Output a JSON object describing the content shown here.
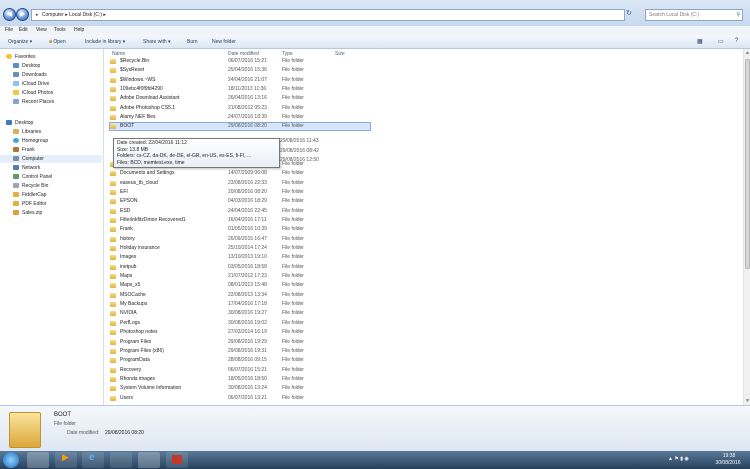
{
  "address": {
    "crumbs": [
      "Computer",
      "Local Disk (C:)"
    ],
    "search_placeholder": "Search Local Disk (C:)"
  },
  "menu": [
    "File",
    "Edit",
    "View",
    "Tools",
    "Help"
  ],
  "toolbar": {
    "organize": "Organize ▾",
    "open": "Open",
    "include": "Include in library ▾",
    "share": "Share with ▾",
    "burn": "Burn",
    "newfolder": "New folder"
  },
  "nav": {
    "favorites": "Favorites",
    "fav_items": [
      "Desktop",
      "Downloads",
      "iCloud Drive",
      "iCloud Photos",
      "Recent Places"
    ],
    "desktop": "Desktop",
    "desk_items": [
      "Libraries",
      "Homegroup",
      "Frank",
      "Computer",
      "Network",
      "Control Panel",
      "Recycle Bin",
      "FiddlerCap",
      "PDF Editor",
      "Sales.zip"
    ]
  },
  "columns": {
    "name": "Name",
    "date": "Date modified",
    "type": "Type",
    "size": "Size"
  },
  "files": [
    {
      "name": "$Recycle.Bin",
      "date": "06/07/2016 15:21",
      "type": "File folder"
    },
    {
      "name": "$SysReset",
      "date": "25/04/2016 15:36",
      "type": "File folder"
    },
    {
      "name": "$Windows.~WS",
      "date": "24/04/2016 21:07",
      "type": "File folder"
    },
    {
      "name": "109ebc4f0f9fd4290",
      "date": "18/11/2013 11:36",
      "type": "File folder"
    },
    {
      "name": "Adobe Download Assistant",
      "date": "26/04/2016 13:16",
      "type": "File folder"
    },
    {
      "name": "Adobe Photoshop CS5.1",
      "date": "21/08/2012 05:23",
      "type": "File folder"
    },
    {
      "name": "Alamy NEF files",
      "date": "24/07/2016 18:39",
      "type": "File folder"
    },
    {
      "name": "BOOT",
      "date": "29/08/2016 08:20",
      "type": "File folder"
    },
    {
      "name": "",
      "date": "",
      "type": ""
    },
    {
      "name": "",
      "date": "",
      "type": ""
    },
    {
      "name": "",
      "date": "",
      "type": ""
    },
    {
      "name": "Collections picture librar administration",
      "date": "01/10/2015 19:54",
      "type": "File folder"
    },
    {
      "name": "Documents and Settings",
      "date": "14/07/2009 06:08",
      "type": "File folder"
    },
    {
      "name": "easeus_tb_cloud",
      "date": "23/08/2016 22:33",
      "type": "File folder"
    },
    {
      "name": "EFI",
      "date": "20/08/2016 08:20",
      "type": "File folder"
    },
    {
      "name": "EPSON",
      "date": "04/03/2016 18:29",
      "type": "File folder"
    },
    {
      "name": "ESD",
      "date": "24/04/2016 22:45",
      "type": "File folder"
    },
    {
      "name": "FilterlnkfitzDmon Recovered1",
      "date": "16/04/2016 17:11",
      "type": "File folder"
    },
    {
      "name": "Frank",
      "date": "01/05/2016 10:39",
      "type": "File folder"
    },
    {
      "name": "history",
      "date": "26/09/2015 16:47",
      "type": "File folder"
    },
    {
      "name": "Holiday insurance",
      "date": "25/10/2014 17:24",
      "type": "File folder"
    },
    {
      "name": "Images",
      "date": "13/10/2013 19:10",
      "type": "File folder"
    },
    {
      "name": "inetpub",
      "date": "03/05/2016 18:58",
      "type": "File folder"
    },
    {
      "name": "Maps",
      "date": "21/07/2012 17:23",
      "type": "File folder"
    },
    {
      "name": "Maps_x5",
      "date": "08/01/2013 15:48",
      "type": "File folder"
    },
    {
      "name": "MSOCache",
      "date": "22/08/2013 13:34",
      "type": "File folder"
    },
    {
      "name": "My Backups",
      "date": "17/04/2016 17:18",
      "type": "File folder"
    },
    {
      "name": "NVIDIA",
      "date": "30/08/2016 19:27",
      "type": "File folder"
    },
    {
      "name": "PerfLogs",
      "date": "30/08/2016 19:02",
      "type": "File folder"
    },
    {
      "name": "Photoshop notes",
      "date": "27/03/2014 16:19",
      "type": "File folder"
    },
    {
      "name": "Program Files",
      "date": "29/08/2016 19:29",
      "type": "File folder"
    },
    {
      "name": "Program Files (x86)",
      "date": "29/08/2016 19:31",
      "type": "File folder"
    },
    {
      "name": "ProgramData",
      "date": "28/08/2016 09:15",
      "type": "File folder"
    },
    {
      "name": "Recovery",
      "date": "06/07/2016 15:21",
      "type": "File folder"
    },
    {
      "name": "Rhonda images",
      "date": "18/05/2016 18:50",
      "type": "File folder"
    },
    {
      "name": "System Volume Information",
      "date": "30/08/2016 13:24",
      "type": "File folder"
    },
    {
      "name": "Users",
      "date": "06/07/2016 13:21",
      "type": "File folder"
    }
  ],
  "tooltip": {
    "created": "Date created: 22/04/2016 11:12",
    "size": "Size: 13.8 MB",
    "folders": "Folders: cs-CZ, da-DK, de-DE, el-GR, en-US, es-ES, fi-FI, ...",
    "files": "Files: BCD, memtest.exe, time"
  },
  "hidden_dates": [
    "29/08/2016 11:43",
    "29/08/2016 08:42",
    "29/08/2016 12:50"
  ],
  "details": {
    "name": "BOOT",
    "type": "File folder",
    "modified_label": "Date modified:",
    "modified": "29/08/2016 08:20"
  },
  "clock": {
    "time": "19:38",
    "date": "30/08/2016"
  }
}
